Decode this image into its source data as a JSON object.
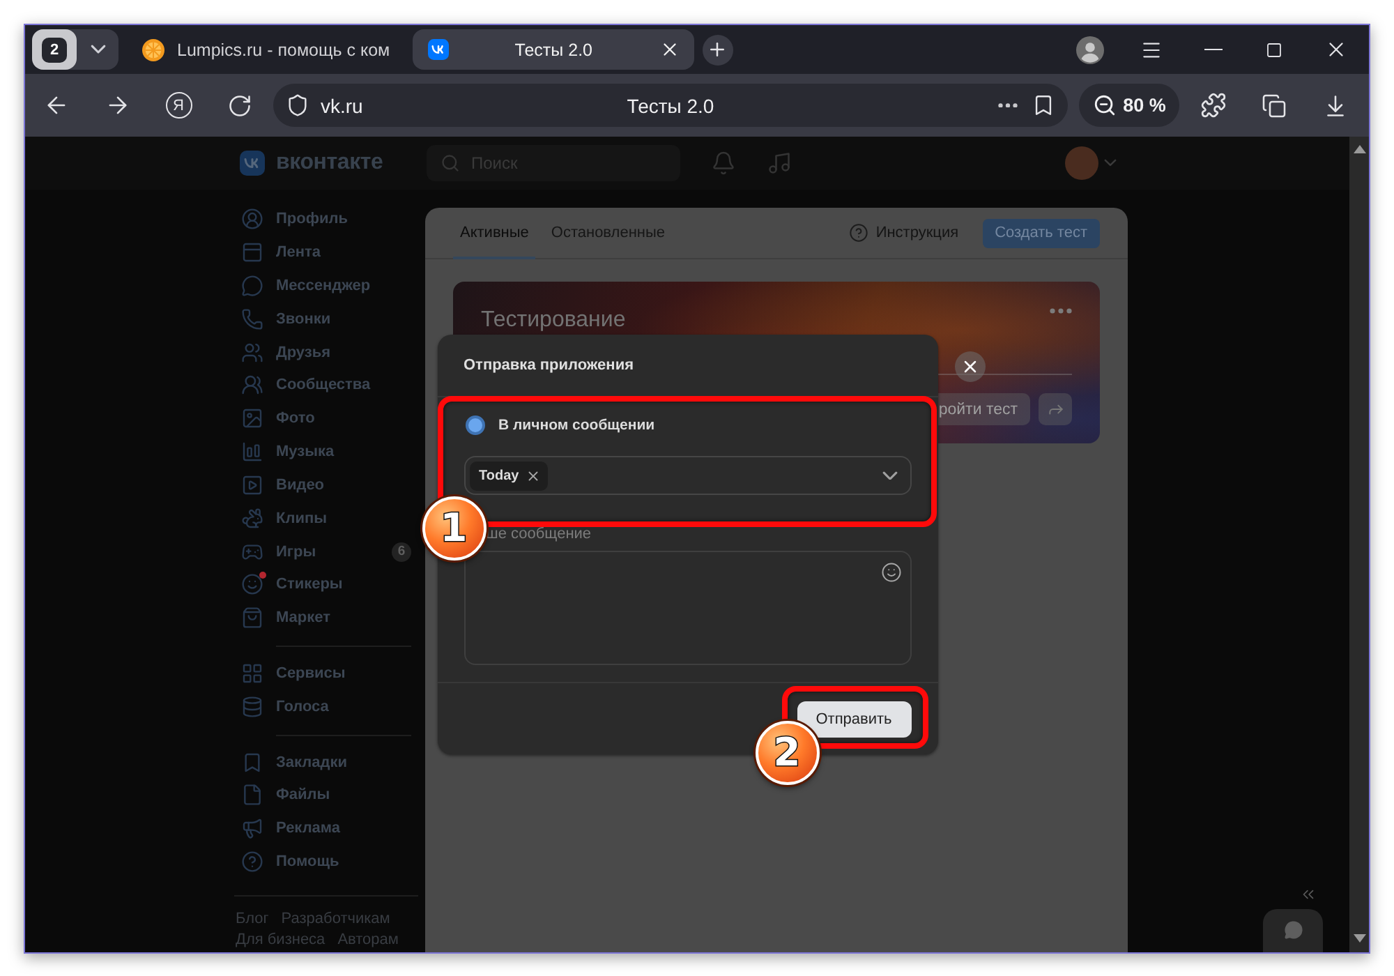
{
  "browser": {
    "tab_count": "2",
    "tabs": [
      {
        "title": "Lumpics.ru - помощь с ком",
        "selected": false
      },
      {
        "title": "Тесты 2.0",
        "selected": true
      }
    ],
    "home_button": "Я",
    "address": {
      "url": "vk.ru",
      "page_title": "Тесты 2.0"
    },
    "zoom": "80 %"
  },
  "site_header": {
    "logo_text": "вконтакте",
    "search": {
      "placeholder": "Поиск"
    }
  },
  "sidebar": {
    "groups": [
      {
        "items": [
          {
            "label": "Профиль",
            "unread": false
          },
          {
            "label": "Лента",
            "unread": false
          },
          {
            "label": "Мессенджер",
            "unread": false
          },
          {
            "label": "Звонки",
            "unread": false
          },
          {
            "label": "Друзья",
            "unread": false
          },
          {
            "label": "Сообщества",
            "unread": false
          },
          {
            "label": "Фото",
            "unread": false
          },
          {
            "label": "Музыка",
            "unread": false
          },
          {
            "label": "Видео",
            "unread": false
          },
          {
            "label": "Клипы",
            "unread": false
          },
          {
            "label": "Игры",
            "unread": false,
            "badge": "6"
          },
          {
            "label": "Стикеры",
            "unread": true
          },
          {
            "label": "Маркет",
            "unread": false
          }
        ]
      },
      {
        "items": [
          {
            "label": "Сервисы",
            "unread": false
          },
          {
            "label": "Голоса",
            "unread": false
          }
        ]
      },
      {
        "items": [
          {
            "label": "Закладки",
            "unread": false
          },
          {
            "label": "Файлы",
            "unread": false
          },
          {
            "label": "Реклама",
            "unread": false
          },
          {
            "label": "Помощь",
            "unread": false
          }
        ]
      }
    ],
    "footer_links": [
      {
        "links": [
          "Блог",
          "Разработчикам"
        ]
      },
      {
        "links": [
          "Для бизнеса",
          "Авторам"
        ]
      }
    ]
  },
  "panel": {
    "tabs": [
      {
        "label": "Активные",
        "selected": true
      },
      {
        "label": "Остановленные",
        "selected": false
      }
    ],
    "help_link": "Инструкция",
    "create_button": "Создать тест",
    "card": {
      "title": "Тестирование",
      "action_button": "ройти тест"
    }
  },
  "modal": {
    "title": "Отправка приложения",
    "option": {
      "label": "В личном сообщении",
      "selected": true
    },
    "recipients": [
      {
        "label": "Today"
      }
    ],
    "message_label": "ше сообщение",
    "submit_button": "Отправить"
  },
  "annotations": [
    {
      "label": "1"
    },
    {
      "label": "2"
    }
  ]
}
